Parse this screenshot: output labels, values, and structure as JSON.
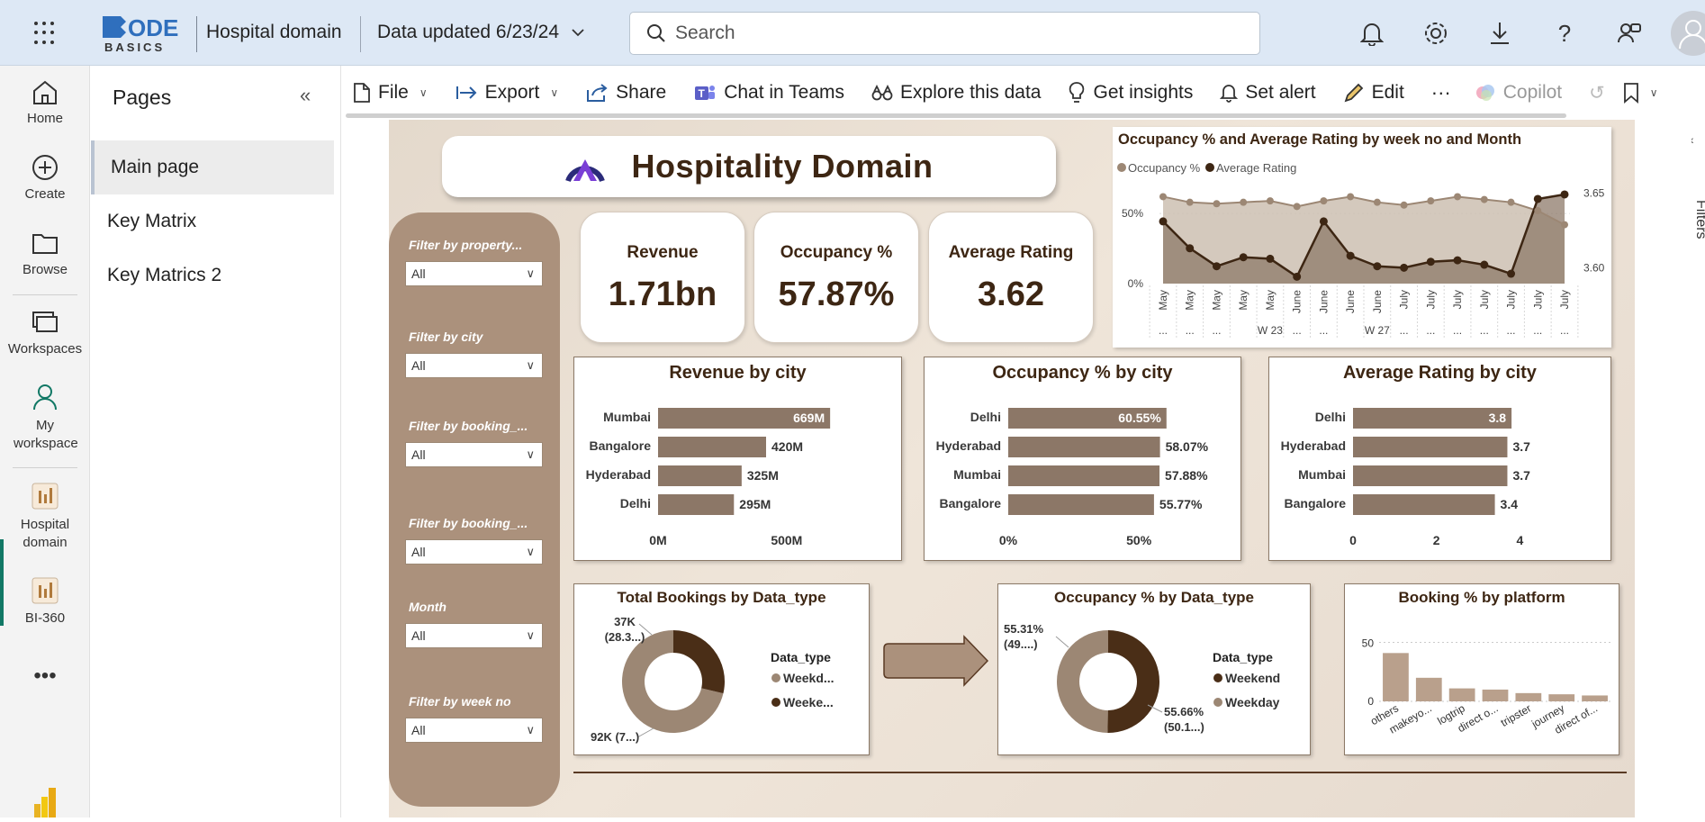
{
  "topbar": {
    "workspace": "Hospital domain",
    "data_updated": "Data updated 6/23/24",
    "search_placeholder": "Search",
    "logo_line1": "ODE",
    "logo_line2": "BASICS"
  },
  "leftnav": [
    {
      "label": "Home",
      "icon": "home-icon"
    },
    {
      "label": "Create",
      "icon": "plus-circle-icon"
    },
    {
      "label": "Browse",
      "icon": "folder-icon"
    },
    {
      "label": "Workspaces",
      "icon": "workspaces-icon"
    },
    {
      "label": "My workspace",
      "icon": "person-icon"
    },
    {
      "label": "Hospital domain",
      "icon": "report-icon"
    },
    {
      "label": "BI-360",
      "icon": "report-icon"
    }
  ],
  "pages": {
    "title": "Pages",
    "items": [
      "Main page",
      "Key Matrix",
      "Key Matrics 2"
    ],
    "selected": "Main page"
  },
  "ribbon": {
    "file": "File",
    "export": "Export",
    "share": "Share",
    "chat": "Chat in Teams",
    "explore": "Explore this data",
    "insights": "Get insights",
    "alert": "Set alert",
    "edit": "Edit",
    "copilot": "Copilot"
  },
  "report": {
    "title": "Hospitality Domain",
    "filters": [
      {
        "label": "Filter by property...",
        "value": "All"
      },
      {
        "label": "Filter by city",
        "value": "All"
      },
      {
        "label": "Filter by booking_...",
        "value": "All"
      },
      {
        "label": "Filter by booking_...",
        "value": "All"
      },
      {
        "label": "Month",
        "value": "All"
      },
      {
        "label": "Filter by week no",
        "value": "All"
      }
    ],
    "kpis": [
      {
        "label": "Revenue",
        "value": "1.71bn"
      },
      {
        "label": "Occupancy %",
        "value": "57.87%"
      },
      {
        "label": "Average Rating",
        "value": "3.62"
      }
    ],
    "filters_pane_label": "Filters"
  },
  "chart_data": [
    {
      "type": "line",
      "title": "Occupancy % and Average Rating by week no and Month",
      "x": [
        "May",
        "May",
        "May",
        "May",
        "May",
        "June",
        "June",
        "June",
        "June",
        "July",
        "July",
        "July",
        "July",
        "July",
        "July",
        "July"
      ],
      "x_sub": [
        "...",
        "...",
        "...",
        "W 23",
        "...",
        "...",
        "W 27",
        "...",
        "...",
        "..."
      ],
      "series": [
        {
          "name": "Occupancy %",
          "axis": "left",
          "values": [
            0.62,
            0.58,
            0.57,
            0.58,
            0.59,
            0.55,
            0.59,
            0.62,
            0.58,
            0.56,
            0.59,
            0.62,
            0.6,
            0.58,
            0.52,
            0.42
          ]
        },
        {
          "name": "Average Rating",
          "axis": "right",
          "values": [
            3.631,
            3.613,
            3.601,
            3.607,
            3.606,
            3.594,
            3.631,
            3.608,
            3.601,
            3.6,
            3.604,
            3.605,
            3.602,
            3.596,
            3.646,
            3.649
          ]
        }
      ],
      "yleft_ticks": [
        "50%",
        "0%"
      ],
      "yright_ticks": [
        "3.65",
        "3.60"
      ],
      "colors": [
        "#9c8774",
        "#3d2613"
      ]
    },
    {
      "type": "bar",
      "title": "Revenue by city",
      "categories": [
        "Mumbai",
        "Bangalore",
        "Hyderabad",
        "Delhi"
      ],
      "values": [
        669,
        420,
        325,
        295
      ],
      "labels": [
        "669M",
        "420M",
        "325M",
        "295M"
      ],
      "xticks": [
        "0M",
        "500M"
      ],
      "xlim": [
        0,
        700
      ]
    },
    {
      "type": "bar",
      "title": "Occupancy % by city",
      "categories": [
        "Delhi",
        "Hyderabad",
        "Mumbai",
        "Bangalore"
      ],
      "values": [
        60.55,
        58.07,
        57.88,
        55.77
      ],
      "labels": [
        "60.55%",
        "58.07%",
        "57.88%",
        "55.77%"
      ],
      "xticks": [
        "0%",
        "50%"
      ],
      "xlim": [
        0,
        62
      ]
    },
    {
      "type": "bar",
      "title": "Average Rating by city",
      "categories": [
        "Delhi",
        "Hyderabad",
        "Mumbai",
        "Bangalore"
      ],
      "values": [
        3.8,
        3.7,
        3.7,
        3.4
      ],
      "labels": [
        "3.8",
        "3.7",
        "3.7",
        "3.4"
      ],
      "xticks": [
        "0",
        "2",
        "4"
      ],
      "xlim": [
        0,
        4.1
      ]
    },
    {
      "type": "pie",
      "title": "Total Bookings by Data_type",
      "legend_title": "Data_type",
      "slices": [
        {
          "name": "Weekd...",
          "value": 92,
          "label": "92K (7...)",
          "color": "#9c8774"
        },
        {
          "name": "Weeke...",
          "value": 37,
          "label": "37K (28.3...)",
          "color": "#4a2e17"
        }
      ]
    },
    {
      "type": "pie",
      "title": "Occupancy % by Data_type",
      "legend_title": "Data_type",
      "slices": [
        {
          "name": "Weekend",
          "value": 55.66,
          "label": "55.66% (50.1...)",
          "color": "#4a2e17"
        },
        {
          "name": "Weekday",
          "value": 55.31,
          "label": "55.31% (49....)",
          "color": "#9c8774"
        }
      ]
    },
    {
      "type": "bar",
      "title": "Booking % by platform",
      "categories": [
        "others",
        "makeyo...",
        "logtrip",
        "direct o...",
        "tripster",
        "journey",
        "direct of..."
      ],
      "values": [
        41,
        20,
        11,
        10,
        7,
        6,
        5
      ],
      "yticks": [
        "50",
        "0"
      ],
      "ylim": [
        0,
        55
      ]
    }
  ]
}
